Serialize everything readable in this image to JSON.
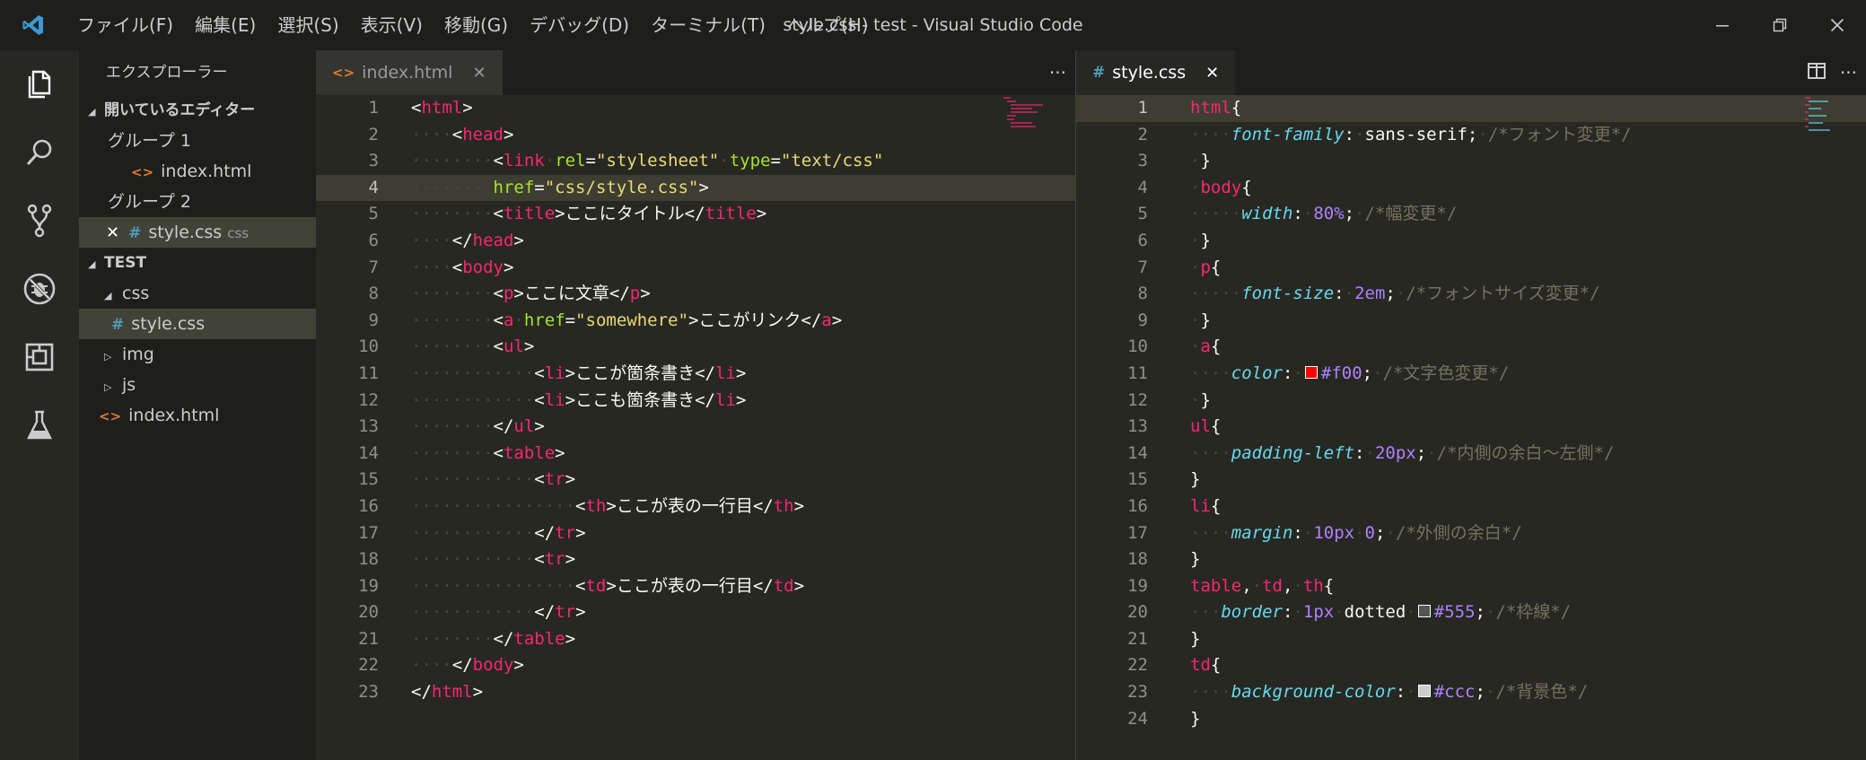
{
  "window": {
    "title": "style.css - test - Visual Studio Code",
    "menu": [
      "ファイル(F)",
      "編集(E)",
      "選択(S)",
      "表示(V)",
      "移動(G)",
      "デバッグ(D)",
      "ターミナル(T)",
      "ヘルプ(H)"
    ]
  },
  "sidebar": {
    "title": "エクスプローラー",
    "open_editors_header": "開いているエディター",
    "group1_label": "グループ 1",
    "group1_file": "index.html",
    "group2_label": "グループ 2",
    "group2_file": "style.css",
    "group2_file_hint": "css",
    "project_header": "TEST",
    "tree": {
      "css_folder": "css",
      "css_file": "style.css",
      "img_folder": "img",
      "js_folder": "js",
      "index_file": "index.html"
    }
  },
  "editor1": {
    "tab_label": "index.html",
    "more_label": "···",
    "lines": [
      {
        "n": "1",
        "t": [
          [
            "t-pun",
            "<"
          ],
          [
            "t-tag",
            "html"
          ],
          [
            "t-pun",
            ">"
          ]
        ]
      },
      {
        "n": "2",
        "t": [
          [
            "dot",
            "····"
          ],
          [
            "t-pun",
            "<"
          ],
          [
            "t-tag",
            "head"
          ],
          [
            "t-pun",
            ">"
          ]
        ]
      },
      {
        "n": "3",
        "t": [
          [
            "dot",
            "········"
          ],
          [
            "t-pun",
            "<"
          ],
          [
            "t-tag",
            "link"
          ],
          [
            "dot",
            "·"
          ],
          [
            "t-attr",
            "rel"
          ],
          [
            "t-pun",
            "="
          ],
          [
            "t-str",
            "\"stylesheet\""
          ],
          [
            "dot",
            "·"
          ],
          [
            "t-attr",
            "type"
          ],
          [
            "t-pun",
            "="
          ],
          [
            "t-str",
            "\"text/css\""
          ]
        ]
      },
      {
        "n": "4",
        "t": [
          [
            "dot",
            "········"
          ],
          [
            "t-attr",
            "href"
          ],
          [
            "t-pun",
            "="
          ],
          [
            "t-str",
            "\"css/style.css\""
          ],
          [
            "t-pun",
            ">"
          ]
        ]
      },
      {
        "n": "5",
        "t": [
          [
            "dot",
            "········"
          ],
          [
            "t-pun",
            "<"
          ],
          [
            "t-tag",
            "title"
          ],
          [
            "t-pun",
            ">"
          ],
          [
            "t-txt",
            "ここにタイトル"
          ],
          [
            "t-pun",
            "</"
          ],
          [
            "t-tag",
            "title"
          ],
          [
            "t-pun",
            ">"
          ]
        ]
      },
      {
        "n": "6",
        "t": [
          [
            "dot",
            "····"
          ],
          [
            "t-pun",
            "</"
          ],
          [
            "t-tag",
            "head"
          ],
          [
            "t-pun",
            ">"
          ]
        ]
      },
      {
        "n": "7",
        "t": [
          [
            "dot",
            "····"
          ],
          [
            "t-pun",
            "<"
          ],
          [
            "t-tag",
            "body"
          ],
          [
            "t-pun",
            ">"
          ]
        ]
      },
      {
        "n": "8",
        "t": [
          [
            "dot",
            "········"
          ],
          [
            "t-pun",
            "<"
          ],
          [
            "t-tag",
            "p"
          ],
          [
            "t-pun",
            ">"
          ],
          [
            "t-txt",
            "ここに文章"
          ],
          [
            "t-pun",
            "</"
          ],
          [
            "t-tag",
            "p"
          ],
          [
            "t-pun",
            ">"
          ]
        ]
      },
      {
        "n": "9",
        "t": [
          [
            "dot",
            "········"
          ],
          [
            "t-pun",
            "<"
          ],
          [
            "t-tag",
            "a"
          ],
          [
            "dot",
            "·"
          ],
          [
            "t-attr",
            "href"
          ],
          [
            "t-pun",
            "="
          ],
          [
            "t-str",
            "\"somewhere\""
          ],
          [
            "t-pun",
            ">"
          ],
          [
            "t-txt",
            "ここがリンク"
          ],
          [
            "t-pun",
            "</"
          ],
          [
            "t-tag",
            "a"
          ],
          [
            "t-pun",
            ">"
          ]
        ]
      },
      {
        "n": "10",
        "t": [
          [
            "dot",
            "········"
          ],
          [
            "t-pun",
            "<"
          ],
          [
            "t-tag",
            "ul"
          ],
          [
            "t-pun",
            ">"
          ]
        ]
      },
      {
        "n": "11",
        "t": [
          [
            "dot",
            "············"
          ],
          [
            "t-pun",
            "<"
          ],
          [
            "t-tag",
            "li"
          ],
          [
            "t-pun",
            ">"
          ],
          [
            "t-txt",
            "ここが箇条書き"
          ],
          [
            "t-pun",
            "</"
          ],
          [
            "t-tag",
            "li"
          ],
          [
            "t-pun",
            ">"
          ]
        ]
      },
      {
        "n": "12",
        "t": [
          [
            "dot",
            "············"
          ],
          [
            "t-pun",
            "<"
          ],
          [
            "t-tag",
            "li"
          ],
          [
            "t-pun",
            ">"
          ],
          [
            "t-txt",
            "ここも箇条書き"
          ],
          [
            "t-pun",
            "</"
          ],
          [
            "t-tag",
            "li"
          ],
          [
            "t-pun",
            ">"
          ]
        ]
      },
      {
        "n": "13",
        "t": [
          [
            "dot",
            "········"
          ],
          [
            "t-pun",
            "</"
          ],
          [
            "t-tag",
            "ul"
          ],
          [
            "t-pun",
            ">"
          ]
        ]
      },
      {
        "n": "14",
        "t": [
          [
            "dot",
            "········"
          ],
          [
            "t-pun",
            "<"
          ],
          [
            "t-tag",
            "table"
          ],
          [
            "t-pun",
            ">"
          ]
        ]
      },
      {
        "n": "15",
        "t": [
          [
            "dot",
            "············"
          ],
          [
            "t-pun",
            "<"
          ],
          [
            "t-tag",
            "tr"
          ],
          [
            "t-pun",
            ">"
          ]
        ]
      },
      {
        "n": "16",
        "t": [
          [
            "dot",
            "················"
          ],
          [
            "t-pun",
            "<"
          ],
          [
            "t-tag",
            "th"
          ],
          [
            "t-pun",
            ">"
          ],
          [
            "t-txt",
            "ここが表の一行目"
          ],
          [
            "t-pun",
            "</"
          ],
          [
            "t-tag",
            "th"
          ],
          [
            "t-pun",
            ">"
          ]
        ]
      },
      {
        "n": "17",
        "t": [
          [
            "dot",
            "············"
          ],
          [
            "t-pun",
            "</"
          ],
          [
            "t-tag",
            "tr"
          ],
          [
            "t-pun",
            ">"
          ]
        ]
      },
      {
        "n": "18",
        "t": [
          [
            "dot",
            "············"
          ],
          [
            "t-pun",
            "<"
          ],
          [
            "t-tag",
            "tr"
          ],
          [
            "t-pun",
            ">"
          ]
        ]
      },
      {
        "n": "19",
        "t": [
          [
            "dot",
            "················"
          ],
          [
            "t-pun",
            "<"
          ],
          [
            "t-tag",
            "td"
          ],
          [
            "t-pun",
            ">"
          ],
          [
            "t-txt",
            "ここが表の一行目"
          ],
          [
            "t-pun",
            "</"
          ],
          [
            "t-tag",
            "td"
          ],
          [
            "t-pun",
            ">"
          ]
        ]
      },
      {
        "n": "20",
        "t": [
          [
            "dot",
            "············"
          ],
          [
            "t-pun",
            "</"
          ],
          [
            "t-tag",
            "tr"
          ],
          [
            "t-pun",
            ">"
          ]
        ]
      },
      {
        "n": "21",
        "t": [
          [
            "dot",
            "········"
          ],
          [
            "t-pun",
            "</"
          ],
          [
            "t-tag",
            "table"
          ],
          [
            "t-pun",
            ">"
          ]
        ]
      },
      {
        "n": "22",
        "t": [
          [
            "dot",
            "····"
          ],
          [
            "t-pun",
            "</"
          ],
          [
            "t-tag",
            "body"
          ],
          [
            "t-pun",
            ">"
          ]
        ]
      },
      {
        "n": "23",
        "t": [
          [
            "t-pun",
            "</"
          ],
          [
            "t-tag",
            "html"
          ],
          [
            "t-pun",
            ">"
          ]
        ]
      }
    ],
    "current_line": 4
  },
  "editor2": {
    "tab_label": "style.css",
    "more_label": "···",
    "colors": {
      "red": "#ff0000",
      "gray555": "#555555",
      "grayccc": "#cccccc"
    },
    "lines": [
      {
        "n": "1",
        "t": [
          [
            "t-sel",
            "html"
          ],
          [
            "t-pun",
            "{"
          ]
        ]
      },
      {
        "n": "2",
        "t": [
          [
            "dot",
            "····"
          ],
          [
            "t-prop",
            "font-family"
          ],
          [
            "t-pun",
            ":"
          ],
          [
            "dot",
            "·"
          ],
          [
            "t-val",
            "sans-serif"
          ],
          [
            "t-pun",
            ";"
          ],
          [
            "dot",
            "·"
          ],
          [
            "t-cmt",
            "/*フォント変更*/"
          ]
        ]
      },
      {
        "n": "3",
        "t": [
          [
            "dot",
            "·"
          ],
          [
            "t-pun",
            "}"
          ]
        ]
      },
      {
        "n": "4",
        "t": [
          [
            "dot",
            "·"
          ],
          [
            "t-sel",
            "body"
          ],
          [
            "t-pun",
            "{"
          ]
        ]
      },
      {
        "n": "5",
        "t": [
          [
            "dot",
            "·····"
          ],
          [
            "t-prop",
            "width"
          ],
          [
            "t-pun",
            ":"
          ],
          [
            "dot",
            "·"
          ],
          [
            "t-num",
            "80%"
          ],
          [
            "t-pun",
            ";"
          ],
          [
            "dot",
            "·"
          ],
          [
            "t-cmt",
            "/*幅変更*/"
          ]
        ]
      },
      {
        "n": "6",
        "t": [
          [
            "dot",
            "·"
          ],
          [
            "t-pun",
            "}"
          ]
        ]
      },
      {
        "n": "7",
        "t": [
          [
            "dot",
            "·"
          ],
          [
            "t-sel",
            "p"
          ],
          [
            "t-pun",
            "{"
          ]
        ]
      },
      {
        "n": "8",
        "t": [
          [
            "dot",
            "·····"
          ],
          [
            "t-prop",
            "font-size"
          ],
          [
            "t-pun",
            ":"
          ],
          [
            "dot",
            "·"
          ],
          [
            "t-num",
            "2em"
          ],
          [
            "t-pun",
            ";"
          ],
          [
            "dot",
            "·"
          ],
          [
            "t-cmt",
            "/*フォントサイズ変更*/"
          ]
        ]
      },
      {
        "n": "9",
        "t": [
          [
            "dot",
            "·"
          ],
          [
            "t-pun",
            "}"
          ]
        ]
      },
      {
        "n": "10",
        "t": [
          [
            "dot",
            "·"
          ],
          [
            "t-sel",
            "a"
          ],
          [
            "t-pun",
            "{"
          ]
        ]
      },
      {
        "n": "11",
        "t": [
          [
            "dot",
            "····"
          ],
          [
            "t-prop",
            "color"
          ],
          [
            "t-pun",
            ":"
          ],
          [
            "dot",
            "·"
          ],
          [
            "swatch",
            "#ff0000"
          ],
          [
            "t-num",
            "#f00"
          ],
          [
            "t-pun",
            ";"
          ],
          [
            "dot",
            "·"
          ],
          [
            "t-cmt",
            "/*文字色変更*/"
          ]
        ]
      },
      {
        "n": "12",
        "t": [
          [
            "dot",
            "·"
          ],
          [
            "t-pun",
            "}"
          ]
        ]
      },
      {
        "n": "13",
        "t": [
          [
            "t-sel",
            "ul"
          ],
          [
            "t-pun",
            "{"
          ]
        ]
      },
      {
        "n": "14",
        "t": [
          [
            "dot",
            "····"
          ],
          [
            "t-prop",
            "padding-left"
          ],
          [
            "t-pun",
            ":"
          ],
          [
            "dot",
            "·"
          ],
          [
            "t-num",
            "20px"
          ],
          [
            "t-pun",
            ";"
          ],
          [
            "dot",
            "·"
          ],
          [
            "t-cmt",
            "/*内側の余白～左側*/"
          ]
        ]
      },
      {
        "n": "15",
        "t": [
          [
            "t-pun",
            "}"
          ]
        ]
      },
      {
        "n": "16",
        "t": [
          [
            "t-sel",
            "li"
          ],
          [
            "t-pun",
            "{"
          ]
        ]
      },
      {
        "n": "17",
        "t": [
          [
            "dot",
            "····"
          ],
          [
            "t-prop",
            "margin"
          ],
          [
            "t-pun",
            ":"
          ],
          [
            "dot",
            "·"
          ],
          [
            "t-num",
            "10px"
          ],
          [
            "dot",
            "·"
          ],
          [
            "t-num",
            "0"
          ],
          [
            "t-pun",
            ";"
          ],
          [
            "dot",
            "·"
          ],
          [
            "t-cmt",
            "/*外側の余白*/"
          ]
        ]
      },
      {
        "n": "18",
        "t": [
          [
            "t-pun",
            "}"
          ]
        ]
      },
      {
        "n": "19",
        "t": [
          [
            "t-sel",
            "table"
          ],
          [
            "t-pun",
            ","
          ],
          [
            "dot",
            "·"
          ],
          [
            "t-sel",
            "td"
          ],
          [
            "t-pun",
            ","
          ],
          [
            "dot",
            "·"
          ],
          [
            "t-sel",
            "th"
          ],
          [
            "t-pun",
            "{"
          ]
        ]
      },
      {
        "n": "20",
        "t": [
          [
            "dot",
            "···"
          ],
          [
            "t-prop",
            "border"
          ],
          [
            "t-pun",
            ":"
          ],
          [
            "dot",
            "·"
          ],
          [
            "t-num",
            "1px"
          ],
          [
            "dot",
            "·"
          ],
          [
            "t-val",
            "dotted"
          ],
          [
            "dot",
            "·"
          ],
          [
            "swatch",
            "#555555"
          ],
          [
            "t-num",
            "#555"
          ],
          [
            "t-pun",
            ";"
          ],
          [
            "dot",
            "·"
          ],
          [
            "t-cmt",
            "/*枠線*/"
          ]
        ]
      },
      {
        "n": "21",
        "t": [
          [
            "t-pun",
            "}"
          ]
        ]
      },
      {
        "n": "22",
        "t": [
          [
            "t-sel",
            "td"
          ],
          [
            "t-pun",
            "{"
          ]
        ]
      },
      {
        "n": "23",
        "t": [
          [
            "dot",
            "····"
          ],
          [
            "t-prop",
            "background-color"
          ],
          [
            "t-pun",
            ":"
          ],
          [
            "dot",
            "·"
          ],
          [
            "swatch",
            "#cccccc"
          ],
          [
            "t-num",
            "#ccc"
          ],
          [
            "t-pun",
            ";"
          ],
          [
            "dot",
            "·"
          ],
          [
            "t-cmt",
            "/*背景色*/"
          ]
        ]
      },
      {
        "n": "24",
        "t": [
          [
            "t-pun",
            "}"
          ]
        ]
      }
    ],
    "current_line": 1
  }
}
